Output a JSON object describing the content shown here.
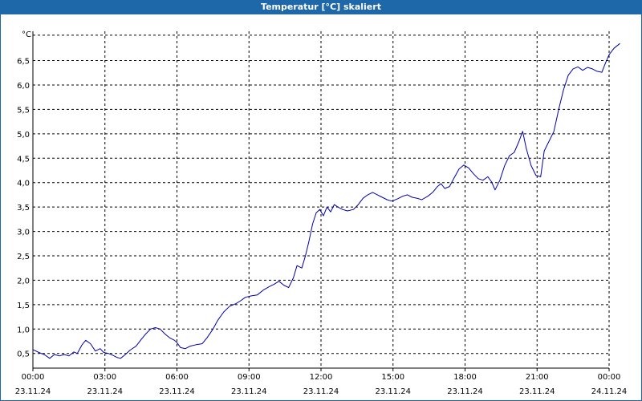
{
  "window": {
    "title": "Temperatur [°C] skaliert"
  },
  "colors": {
    "titlebar": "#1e67a8",
    "line": "#0000aa",
    "grid": "#000000"
  },
  "chart_data": {
    "type": "line",
    "title": "Temperatur [°C] skaliert",
    "ylabel": "°C",
    "xlabel": "",
    "grid": true,
    "ylim": [
      0.2,
      7.1
    ],
    "yticks": [
      "0,5",
      "1,0",
      "1,5",
      "2,0",
      "2,5",
      "3,0",
      "3,5",
      "4,0",
      "4,5",
      "5,0",
      "5,5",
      "6,0",
      "6,5"
    ],
    "xticks": [
      {
        "time": "00:00",
        "date": "23.11.24"
      },
      {
        "time": "03:00",
        "date": "23.11.24"
      },
      {
        "time": "06:00",
        "date": "23.11.24"
      },
      {
        "time": "09:00",
        "date": "23.11.24"
      },
      {
        "time": "12:00",
        "date": "23.11.24"
      },
      {
        "time": "15:00",
        "date": "23.11.24"
      },
      {
        "time": "18:00",
        "date": "23.11.24"
      },
      {
        "time": "21:00",
        "date": "23.11.24"
      },
      {
        "time": "00:00",
        "date": "24.11.24"
      }
    ],
    "x_unit": "hours from 00:00 23.11.24",
    "series": [
      {
        "values": [
          [
            0.0,
            0.58
          ],
          [
            0.25,
            0.52
          ],
          [
            0.5,
            0.47
          ],
          [
            0.7,
            0.4
          ],
          [
            0.9,
            0.48
          ],
          [
            1.1,
            0.45
          ],
          [
            1.3,
            0.48
          ],
          [
            1.5,
            0.45
          ],
          [
            1.7,
            0.53
          ],
          [
            1.85,
            0.5
          ],
          [
            2.05,
            0.68
          ],
          [
            2.2,
            0.77
          ],
          [
            2.4,
            0.7
          ],
          [
            2.6,
            0.55
          ],
          [
            2.8,
            0.6
          ],
          [
            2.95,
            0.52
          ],
          [
            3.15,
            0.5
          ],
          [
            3.3,
            0.47
          ],
          [
            3.5,
            0.42
          ],
          [
            3.65,
            0.4
          ],
          [
            3.85,
            0.48
          ],
          [
            4.05,
            0.57
          ],
          [
            4.3,
            0.65
          ],
          [
            4.5,
            0.78
          ],
          [
            4.7,
            0.9
          ],
          [
            4.9,
            1.0
          ],
          [
            5.1,
            1.03
          ],
          [
            5.3,
            1.0
          ],
          [
            5.5,
            0.9
          ],
          [
            5.7,
            0.82
          ],
          [
            5.9,
            0.77
          ],
          [
            6.0,
            0.72
          ],
          [
            6.15,
            0.62
          ],
          [
            6.35,
            0.6
          ],
          [
            6.55,
            0.65
          ],
          [
            6.8,
            0.68
          ],
          [
            7.05,
            0.7
          ],
          [
            7.25,
            0.82
          ],
          [
            7.5,
            1.0
          ],
          [
            7.7,
            1.18
          ],
          [
            7.95,
            1.35
          ],
          [
            8.2,
            1.47
          ],
          [
            8.45,
            1.52
          ],
          [
            8.65,
            1.58
          ],
          [
            8.85,
            1.65
          ],
          [
            9.1,
            1.68
          ],
          [
            9.35,
            1.7
          ],
          [
            9.6,
            1.8
          ],
          [
            9.85,
            1.87
          ],
          [
            10.05,
            1.92
          ],
          [
            10.25,
            1.98
          ],
          [
            10.45,
            1.9
          ],
          [
            10.65,
            1.85
          ],
          [
            10.85,
            2.05
          ],
          [
            11.0,
            2.3
          ],
          [
            11.2,
            2.25
          ],
          [
            11.35,
            2.5
          ],
          [
            11.5,
            2.8
          ],
          [
            11.65,
            3.15
          ],
          [
            11.8,
            3.38
          ],
          [
            11.95,
            3.45
          ],
          [
            12.1,
            3.32
          ],
          [
            12.25,
            3.5
          ],
          [
            12.4,
            3.4
          ],
          [
            12.55,
            3.55
          ],
          [
            12.7,
            3.5
          ],
          [
            12.9,
            3.45
          ],
          [
            13.1,
            3.42
          ],
          [
            13.35,
            3.45
          ],
          [
            13.55,
            3.55
          ],
          [
            13.75,
            3.68
          ],
          [
            13.95,
            3.75
          ],
          [
            14.15,
            3.8
          ],
          [
            14.35,
            3.75
          ],
          [
            14.55,
            3.7
          ],
          [
            14.75,
            3.65
          ],
          [
            14.95,
            3.62
          ],
          [
            15.2,
            3.67
          ],
          [
            15.4,
            3.72
          ],
          [
            15.6,
            3.75
          ],
          [
            15.8,
            3.7
          ],
          [
            16.0,
            3.68
          ],
          [
            16.2,
            3.65
          ],
          [
            16.45,
            3.72
          ],
          [
            16.65,
            3.8
          ],
          [
            16.85,
            3.92
          ],
          [
            17.0,
            3.98
          ],
          [
            17.15,
            3.88
          ],
          [
            17.35,
            3.92
          ],
          [
            17.55,
            4.1
          ],
          [
            17.75,
            4.28
          ],
          [
            17.95,
            4.36
          ],
          [
            18.15,
            4.3
          ],
          [
            18.35,
            4.18
          ],
          [
            18.55,
            4.08
          ],
          [
            18.75,
            4.05
          ],
          [
            18.95,
            4.12
          ],
          [
            19.1,
            4.02
          ],
          [
            19.25,
            3.85
          ],
          [
            19.45,
            4.05
          ],
          [
            19.65,
            4.35
          ],
          [
            19.85,
            4.55
          ],
          [
            20.05,
            4.62
          ],
          [
            20.25,
            4.85
          ],
          [
            20.4,
            5.05
          ],
          [
            20.55,
            4.7
          ],
          [
            20.75,
            4.35
          ],
          [
            20.95,
            4.15
          ],
          [
            21.15,
            4.12
          ],
          [
            21.3,
            4.65
          ],
          [
            21.5,
            4.85
          ],
          [
            21.7,
            5.05
          ],
          [
            21.9,
            5.5
          ],
          [
            22.1,
            5.9
          ],
          [
            22.3,
            6.2
          ],
          [
            22.5,
            6.33
          ],
          [
            22.7,
            6.37
          ],
          [
            22.9,
            6.3
          ],
          [
            23.1,
            6.36
          ],
          [
            23.3,
            6.33
          ],
          [
            23.5,
            6.28
          ],
          [
            23.7,
            6.26
          ],
          [
            23.85,
            6.45
          ],
          [
            24.0,
            6.62
          ],
          [
            24.2,
            6.75
          ],
          [
            24.45,
            6.85
          ]
        ]
      }
    ]
  }
}
